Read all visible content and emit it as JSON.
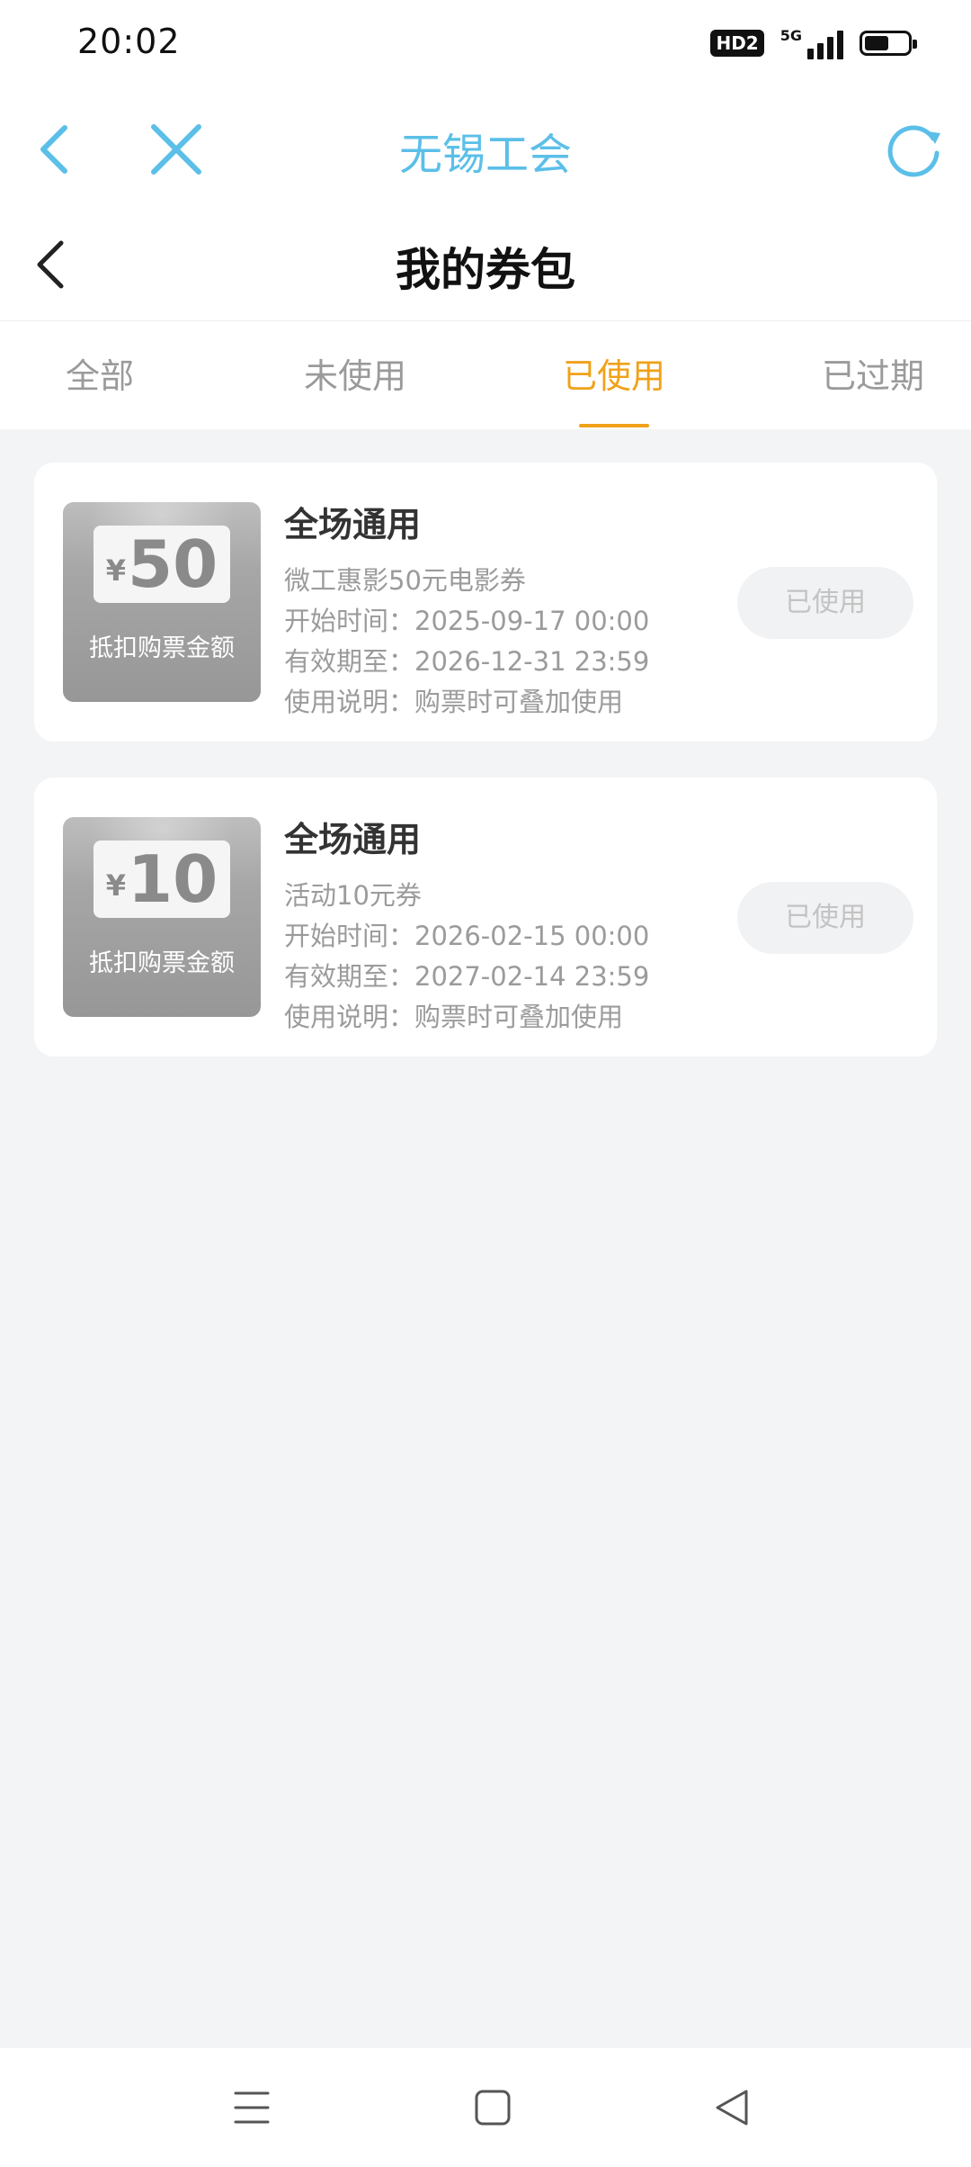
{
  "status_bar": {
    "time": "20:02",
    "hd_label": "HD2",
    "network_label": "5G"
  },
  "web_container": {
    "title": "无锡工会"
  },
  "page": {
    "title": "我的券包"
  },
  "tabs": [
    {
      "label": "全部",
      "active": false
    },
    {
      "label": "未使用",
      "active": false
    },
    {
      "label": "已使用",
      "active": true
    },
    {
      "label": "已过期",
      "active": false
    }
  ],
  "coupons": [
    {
      "currency": "¥",
      "amount": "50",
      "thumb_sub": "抵扣购票金额",
      "title": "全场通用",
      "desc": "微工惠影50元电影券",
      "start": "开始时间：2025-09-17 00:00",
      "expire": "有效期至：2026-12-31 23:59",
      "note": "使用说明：购票时可叠加使用",
      "status": "已使用"
    },
    {
      "currency": "¥",
      "amount": "10",
      "thumb_sub": "抵扣购票金额",
      "title": "全场通用",
      "desc": "活动10元券",
      "start": "开始时间：2026-02-15 00:00",
      "expire": "有效期至：2027-02-14 23:59",
      "note": "使用说明：购票时可叠加使用",
      "status": "已使用"
    }
  ],
  "colors": {
    "accent": "#f0a21a",
    "web_title": "#5bbfe8",
    "background": "#f3f4f6"
  }
}
